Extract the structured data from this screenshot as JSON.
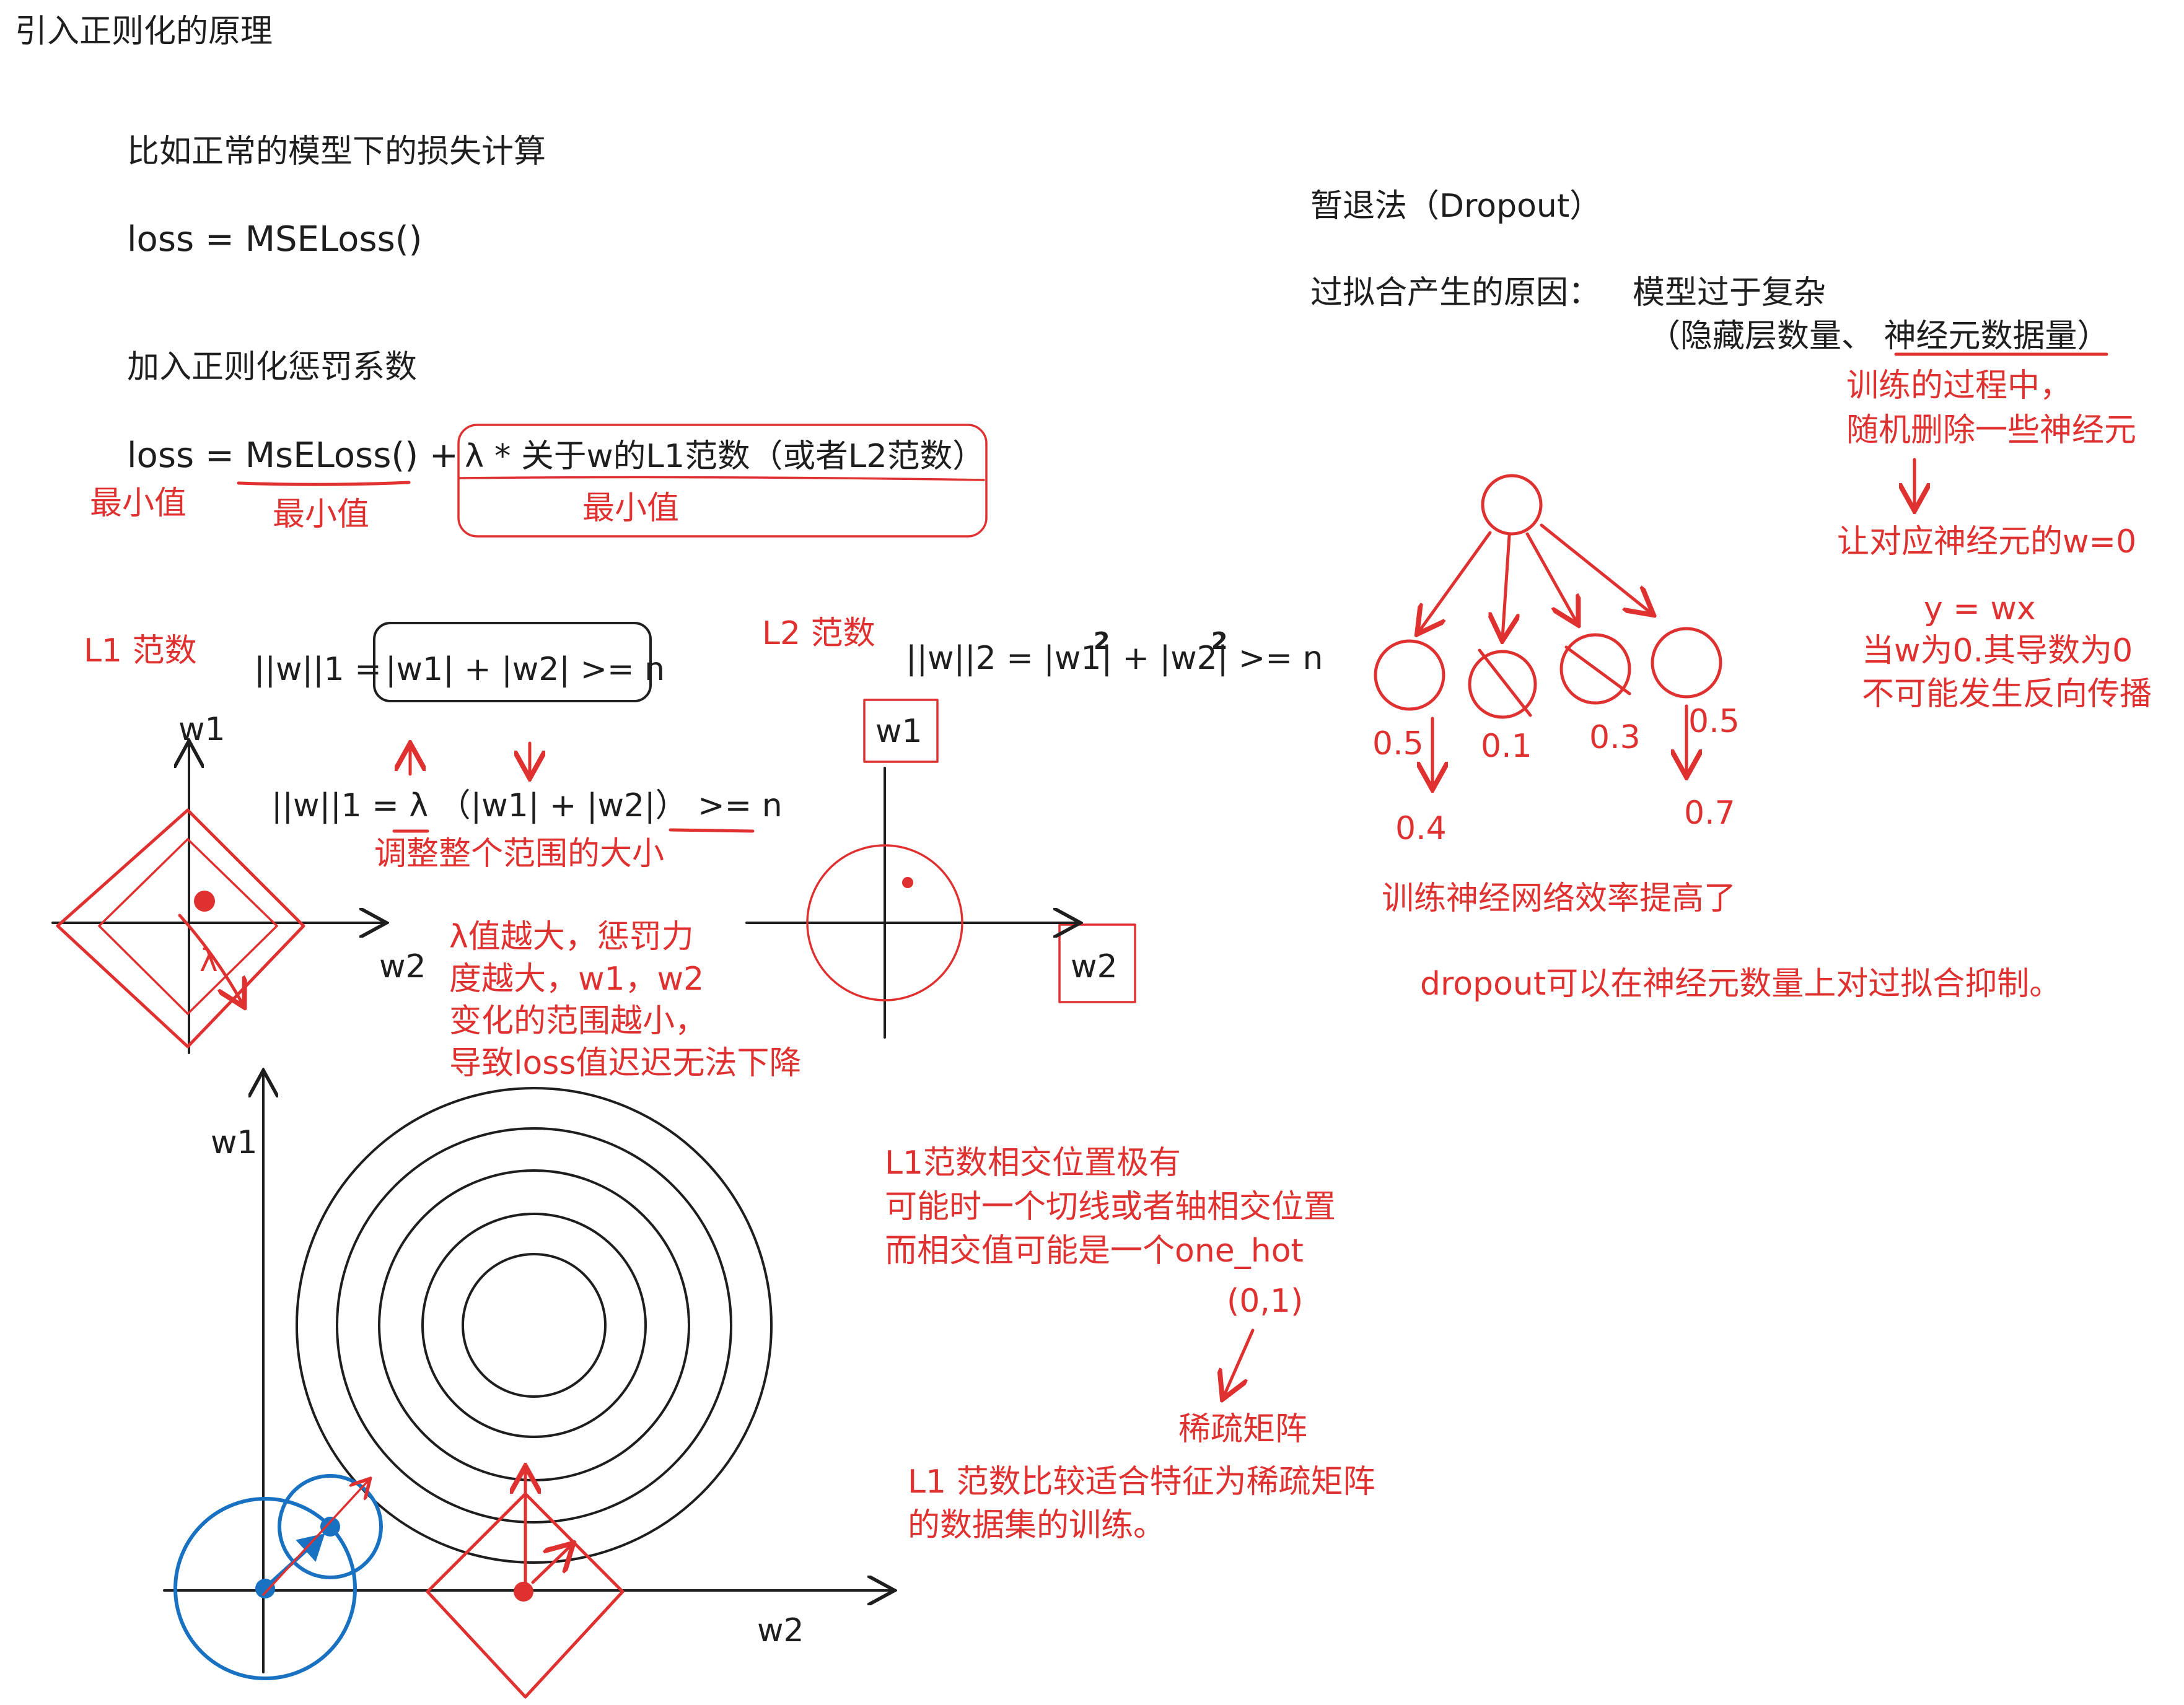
{
  "colors": {
    "ink": "#1e1e1e",
    "accent_red": "#e03131",
    "accent_blue": "#1971c2",
    "background": "#ffffff"
  },
  "title": "引入正则化的原理",
  "left": {
    "normal_loss_intro": "比如正常的模型下的损失计算",
    "loss_plain": "loss = MSELoss()",
    "add_penalty_intro": "加入正则化惩罚系数",
    "loss_reg_prefix": "loss = ",
    "loss_reg_mse": "MsELoss()",
    "loss_reg_plus": " + ",
    "loss_reg_penalty": "λ * 关于w的L1范数（或者L2范数）",
    "min_value_1": "最小值",
    "min_value_2": "最小值",
    "min_value_3": "最小值"
  },
  "l1": {
    "heading": "L1 范数",
    "norm_formula_left": "||w||1 = ",
    "norm_formula_box": "|w1| + |w2| >= n",
    "scaled_formula_left": "||w||1 = ",
    "scaled_lambda": "λ",
    "scaled_formula_right": "（|w1| + |w2|）  >= n",
    "scaled_note": "调整整个范围的大小",
    "axis_w1": "w1",
    "axis_w2": "w2",
    "lambda_mark": "λ",
    "lambda_note": [
      "λ值越大，惩罚力",
      "度越大，w1，w2",
      "变化的范围越小，",
      "导致loss值迟迟无法下降"
    ]
  },
  "l2": {
    "heading": "L2 范数",
    "norm_formula": "||w||2 = |w1|  + |w2|  >= n",
    "superscript_1": "2",
    "superscript_2": "2",
    "axis_w1": "w1",
    "axis_w2": "w2"
  },
  "bottom": {
    "axis_w1": "w1",
    "axis_w2": "w2",
    "intersect_note": [
      "L1范数相交位置极有",
      "可能时一个切线或者轴相交位置",
      "而相交值可能是一个one_hot"
    ],
    "one_hot_point": "(0,1)",
    "sparse_label": "稀疏矩阵",
    "sparse_note": [
      "L1 范数比较适合特征为稀疏矩阵",
      "的数据集的训练。"
    ]
  },
  "dropout": {
    "heading": "暂退法（Dropout）",
    "cause_label": "过拟合产生的原因：",
    "cause_value": "模型过于复杂",
    "cause_detail_open": "（隐藏层数量、",
    "cause_detail_highlight": "神经元数据量）",
    "train_note": [
      "训练的过程中，",
      "随机删除一些神经元"
    ],
    "set_zero": "让对应神经元的w=0",
    "equation": "y = wx",
    "no_backprop": [
      "当w为0.其导数为0",
      "不可能发生反向传播"
    ],
    "node_values": [
      "0.5",
      "0.1",
      "0.3",
      "0.5"
    ],
    "updated_values": [
      "0.4",
      "0.7"
    ],
    "efficiency_note": "训练神经网络效率提高了",
    "summary": "dropout可以在神经元数量上对过拟合抑制。"
  }
}
